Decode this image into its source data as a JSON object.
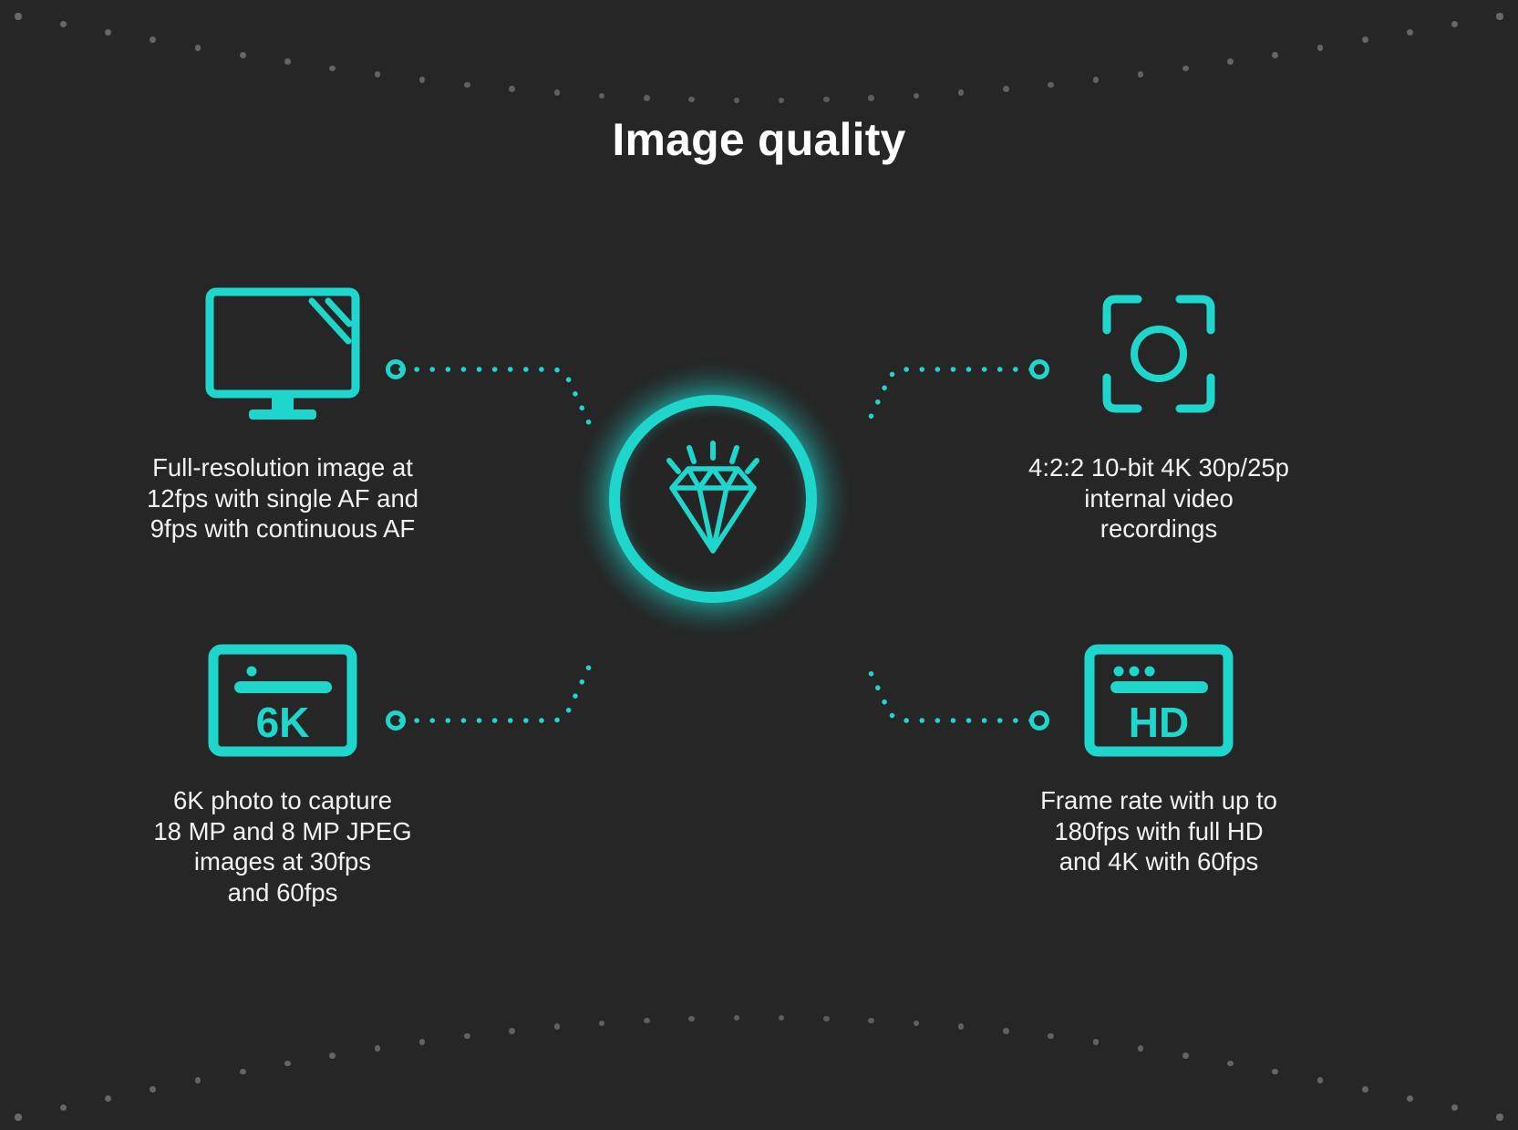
{
  "page": {
    "title": "Image quality",
    "background_color": "#262626",
    "accent_color": "#1fd6cd",
    "text_color": "#f2f2f2",
    "decor_dot_color": "#8a8a8a"
  },
  "center": {
    "icon": "diamond-icon",
    "label": "Image quality"
  },
  "features": [
    {
      "id": "full-resolution",
      "icon": "monitor-icon",
      "lines": [
        "Full-resolution image at",
        "12fps with single AF and",
        "9fps with continuous AF"
      ]
    },
    {
      "id": "internal-video",
      "icon": "focus-frame-icon",
      "lines": [
        "4:2:2 10-bit 4K 30p/25p",
        "internal video",
        "recordings"
      ]
    },
    {
      "id": "6k-photo",
      "icon": "6k-browser-icon",
      "icon_label": "6K",
      "lines": [
        "6K photo to capture",
        "18 MP and 8 MP JPEG",
        "images at 30fps",
        "and 60fps"
      ]
    },
    {
      "id": "frame-rate",
      "icon": "hd-browser-icon",
      "icon_label": "HD",
      "lines": [
        "Frame rate with up to",
        "180fps with full HD",
        "and 4K with 60fps"
      ]
    }
  ]
}
